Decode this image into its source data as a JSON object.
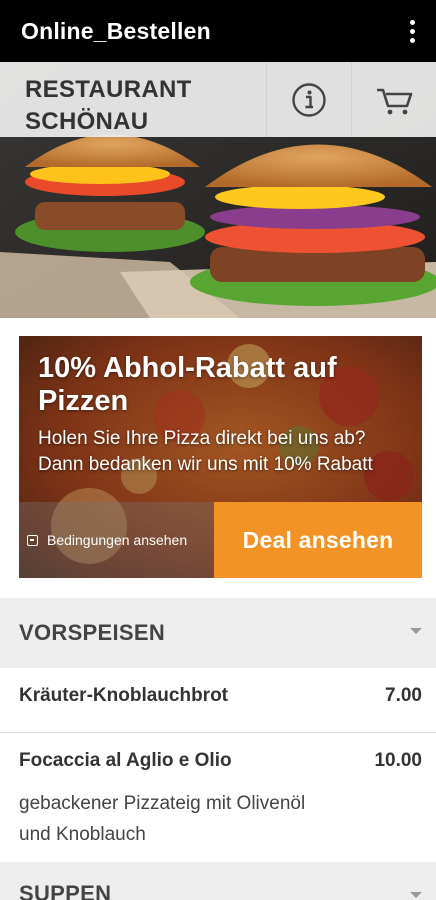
{
  "app_bar": {
    "title": "Online_Bestellen",
    "menu_icon": "more-vertical-icon"
  },
  "restaurant_bar": {
    "name": "RESTAURANT SCHÖNAU",
    "info_icon": "info-icon",
    "cart_icon": "cart-icon"
  },
  "deal": {
    "headline": "10% Abhol-Rabatt auf Pizzen",
    "description": "Holen Sie Ihre Pizza direkt bei uns ab? Dann bedanken wir uns mit 10% Rabatt",
    "terms_label": "Bedingungen ansehen",
    "cta_label": "Deal ansehen",
    "accent_color": "#f39325"
  },
  "menu": {
    "categories": [
      {
        "label": "VORSPEISEN",
        "items": [
          {
            "name": "Kräuter-Knoblauchbrot",
            "price": "7.00"
          },
          {
            "name": "Focaccia al Aglio e Olio",
            "price": "10.00",
            "description": "gebackener Pizzateig mit Olivenöl und Knoblauch"
          }
        ]
      },
      {
        "label": "SUPPEN"
      }
    ]
  }
}
